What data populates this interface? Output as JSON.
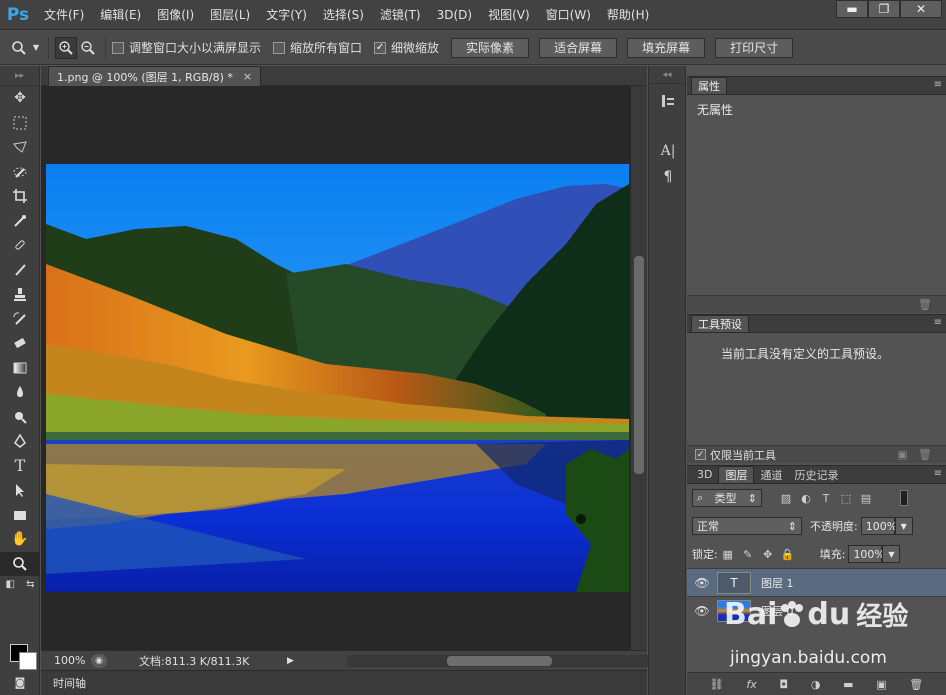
{
  "app": {
    "logo": "Ps"
  },
  "menu": [
    "文件(F)",
    "编辑(E)",
    "图像(I)",
    "图层(L)",
    "文字(Y)",
    "选择(S)",
    "滤镜(T)",
    "3D(D)",
    "视图(V)",
    "窗口(W)",
    "帮助(H)"
  ],
  "window_controls": {
    "minimize": "▬",
    "restore": "❐",
    "close": "✕"
  },
  "options": {
    "resize_windows": "调整窗口大小以满屏显示",
    "zoom_all_windows": "缩放所有窗口",
    "scrubby_zoom": "细微缩放",
    "scrubby_checked_mark": "✓",
    "buttons": [
      "实际像素",
      "适合屏幕",
      "填充屏幕",
      "打印尺寸"
    ]
  },
  "document": {
    "tab_title": "1.png @ 100% (图层 1, RGB/8) *",
    "tab_close": "×",
    "zoom": "100%",
    "doc_info": "文档:811.3 K/811.3K",
    "timeline": "时间轴"
  },
  "properties": {
    "tab": "属性",
    "body": "无属性"
  },
  "tool_presets": {
    "tab": "工具预设",
    "body": "当前工具没有定义的工具预设。",
    "current_tool_only": "仅限当前工具"
  },
  "layers_panel": {
    "tabs": [
      "3D",
      "图层",
      "通道",
      "历史记录"
    ],
    "filter_kind": "类型",
    "blend_mode": "正常",
    "opacity_label": "不透明度:",
    "opacity_value": "100%",
    "lock_label": "锁定:",
    "fill_label": "填充:",
    "fill_value": "100%",
    "layers": [
      {
        "name": "图层 1",
        "thumb": "T"
      },
      {
        "name": "图层 0",
        "thumb": ""
      }
    ],
    "footer_icons": [
      "link-icon",
      "fx-icon",
      "mask-icon",
      "adjustment-icon",
      "group-icon",
      "new-layer-icon",
      "trash-icon"
    ],
    "fx_label": "fx"
  },
  "watermark": {
    "brand": "Bai",
    "brand2": "du",
    "cn": "经验",
    "url": "jingyan.baidu.com"
  }
}
